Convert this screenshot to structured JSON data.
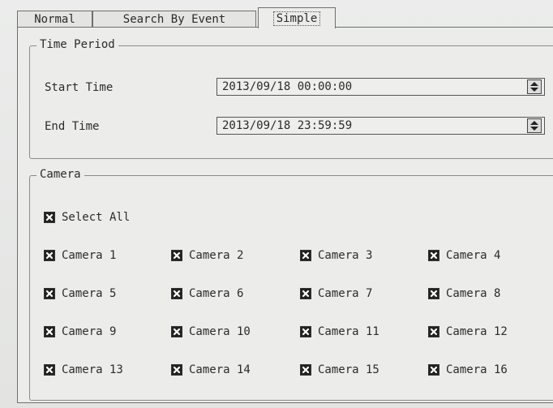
{
  "tabs": [
    {
      "label": "Normal"
    },
    {
      "label": "Search By Event"
    },
    {
      "label": "Simple"
    }
  ],
  "active_tab": "Simple",
  "time_period": {
    "title": "Time Period",
    "start_label": "Start Time",
    "start_value": "2013/09/18 00:00:00",
    "end_label": "End Time",
    "end_value": "2013/09/18 23:59:59"
  },
  "camera": {
    "title": "Camera",
    "select_all": {
      "label": "Select All",
      "checked": true
    },
    "items": [
      {
        "label": "Camera 1",
        "checked": true
      },
      {
        "label": "Camera 2",
        "checked": true
      },
      {
        "label": "Camera 3",
        "checked": true
      },
      {
        "label": "Camera 4",
        "checked": true
      },
      {
        "label": "Camera 5",
        "checked": true
      },
      {
        "label": "Camera 6",
        "checked": true
      },
      {
        "label": "Camera 7",
        "checked": true
      },
      {
        "label": "Camera 8",
        "checked": true
      },
      {
        "label": "Camera 9",
        "checked": true
      },
      {
        "label": "Camera 10",
        "checked": true
      },
      {
        "label": "Camera 11",
        "checked": true
      },
      {
        "label": "Camera 12",
        "checked": true
      },
      {
        "label": "Camera 13",
        "checked": true
      },
      {
        "label": "Camera 14",
        "checked": true
      },
      {
        "label": "Camera 15",
        "checked": true
      },
      {
        "label": "Camera 16",
        "checked": true
      }
    ]
  }
}
